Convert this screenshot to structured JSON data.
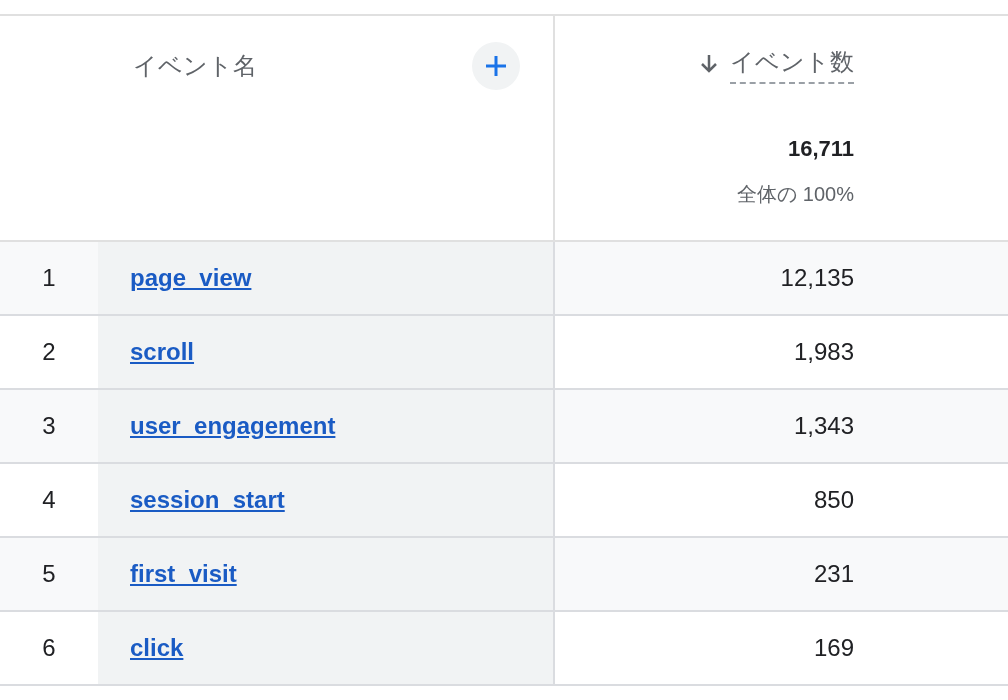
{
  "table": {
    "columns": [
      {
        "label": "イベント名"
      },
      {
        "label": "イベント数",
        "sorted": true
      }
    ],
    "totals": {
      "value": "16,711",
      "share": "全体の 100%"
    },
    "rows": [
      {
        "index": "1",
        "name": "page_view",
        "count": "12,135"
      },
      {
        "index": "2",
        "name": "scroll",
        "count": "1,983"
      },
      {
        "index": "3",
        "name": "user_engagement",
        "count": "1,343"
      },
      {
        "index": "4",
        "name": "session_start",
        "count": "850"
      },
      {
        "index": "5",
        "name": "first_visit",
        "count": "231"
      },
      {
        "index": "6",
        "name": "click",
        "count": "169"
      }
    ]
  }
}
